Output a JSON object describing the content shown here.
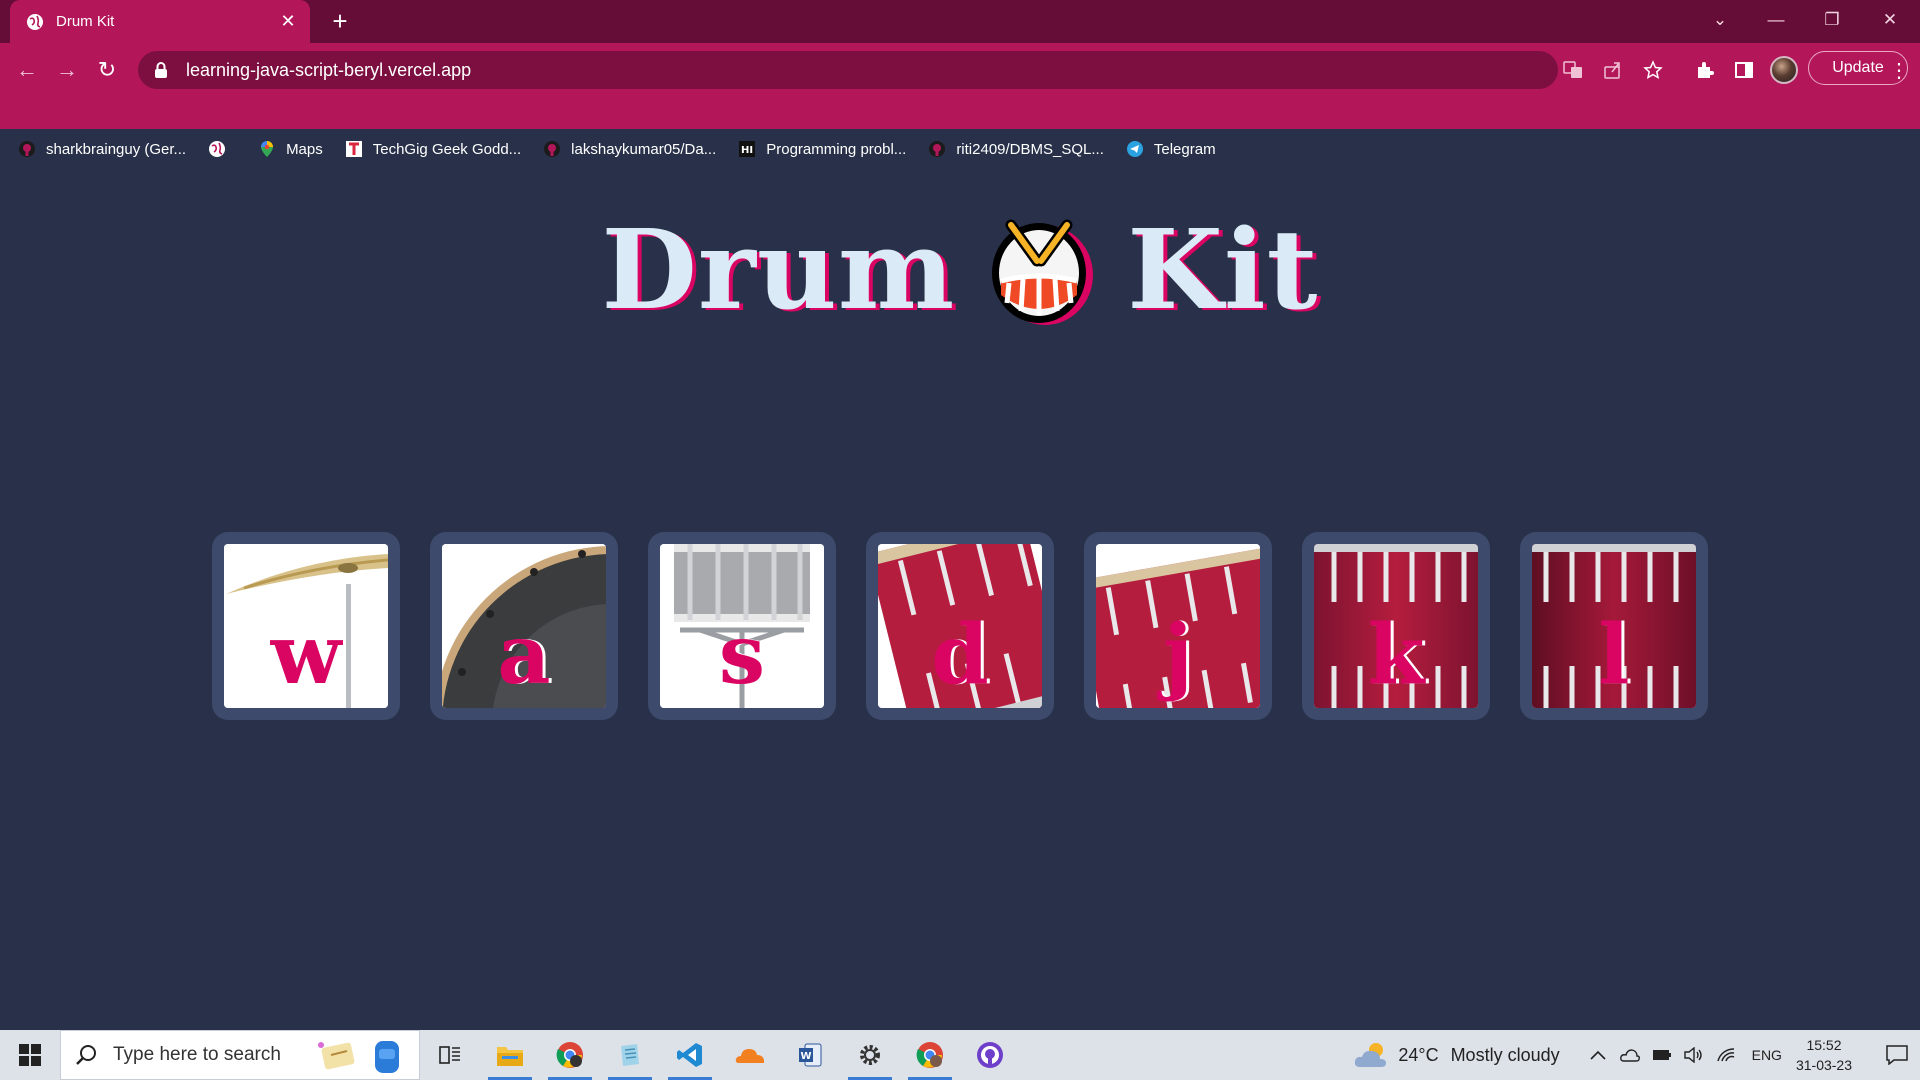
{
  "browser": {
    "tab_title": "Drum Kit",
    "new_tab": "+",
    "url": "learning-java-script-beryl.vercel.app",
    "update_label": "Update",
    "window_controls": {
      "minimize": "—",
      "maximize": "❐",
      "close": "✕"
    },
    "bookmarks": [
      {
        "label": "sharkbrainguy (Ger...",
        "icon": "github-icon"
      },
      {
        "label": "",
        "icon": "globe-icon"
      },
      {
        "label": "Maps",
        "icon": "maps-icon"
      },
      {
        "label": "TechGig Geek Godd...",
        "icon": "techgig-icon"
      },
      {
        "label": "lakshaykumar05/Da...",
        "icon": "github-icon"
      },
      {
        "label": "Programming probl...",
        "icon": "hackerearth-icon"
      },
      {
        "label": "riti2409/DBMS_SQL...",
        "icon": "github-icon"
      },
      {
        "label": "Telegram",
        "icon": "telegram-icon"
      }
    ]
  },
  "page": {
    "title_left": "Drum",
    "title_right": "Kit",
    "title_emoji": "drum-emoji",
    "keys": [
      {
        "letter": "w",
        "instrument": "crash-cymbal"
      },
      {
        "letter": "a",
        "instrument": "kick-drum"
      },
      {
        "letter": "s",
        "instrument": "snare-drum"
      },
      {
        "letter": "d",
        "instrument": "tom-1"
      },
      {
        "letter": "j",
        "instrument": "tom-2"
      },
      {
        "letter": "k",
        "instrument": "tom-3"
      },
      {
        "letter": "l",
        "instrument": "tom-4"
      }
    ],
    "colors": {
      "background": "#283149",
      "accent": "#da0463",
      "title": "#daeaf7",
      "key_frame": "#3d4a6b"
    }
  },
  "taskbar": {
    "search_placeholder": "Type here to search",
    "weather": {
      "temp": "24°C",
      "condition": "Mostly cloudy"
    },
    "language": "ENG",
    "time": "15:52",
    "date": "31-03-23"
  }
}
